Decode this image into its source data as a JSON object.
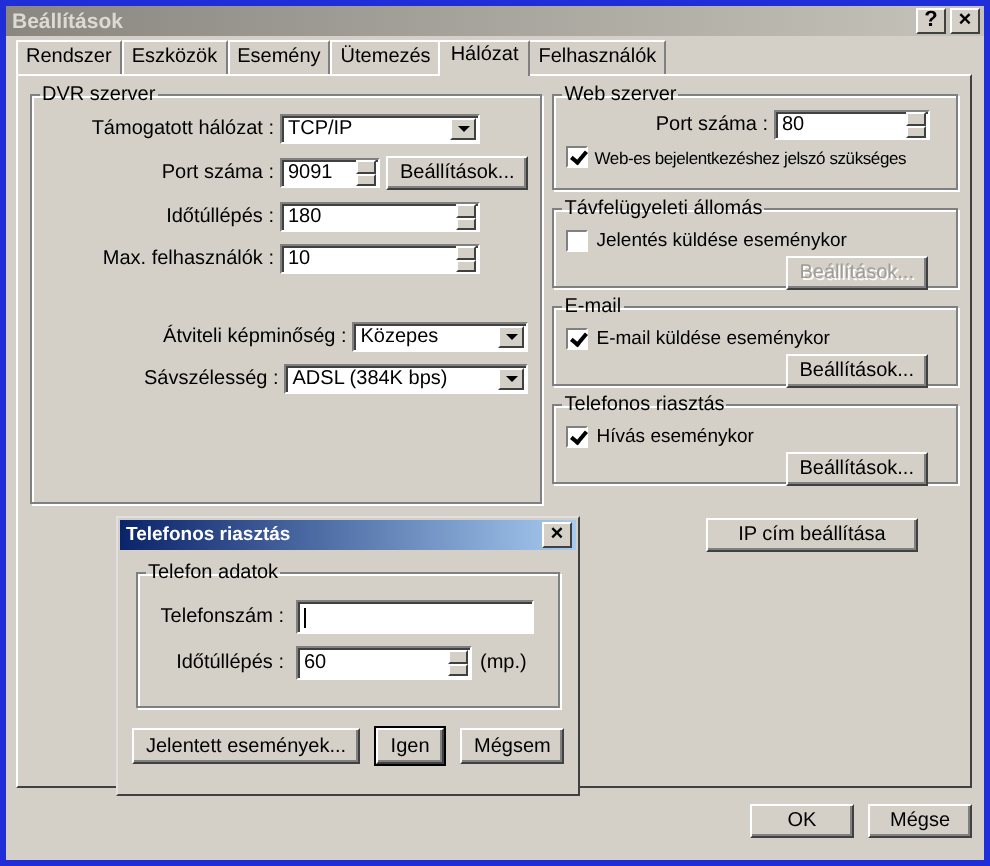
{
  "window": {
    "title": "Beállítások",
    "title_buttons": [
      "?",
      "×"
    ]
  },
  "tabs": [
    {
      "label": "Rendszer",
      "selected": false
    },
    {
      "label": "Eszközök",
      "selected": false
    },
    {
      "label": "Esemény",
      "selected": false
    },
    {
      "label": "Ütemezés",
      "selected": false
    },
    {
      "label": "Hálózat",
      "selected": true
    },
    {
      "label": "Felhasználók",
      "selected": false
    }
  ],
  "dvr_server": {
    "title": "DVR szerver",
    "fields": [
      {
        "kind": "dropdown",
        "label": "Támogatott hálózat :",
        "value": "TCP/IP"
      },
      {
        "kind": "spin",
        "label": "Port száma :",
        "value": "9091",
        "button": "Beállítások..."
      },
      {
        "kind": "spin",
        "label": "Időtúllépés :",
        "value": "180"
      },
      {
        "kind": "spin",
        "label": "Max. felhasználók :",
        "value": "10"
      }
    ],
    "quality_fields": [
      {
        "kind": "dropdown",
        "label": "Átviteli képminőség :",
        "value": "Közepes"
      },
      {
        "kind": "dropdown",
        "label": "Sávszélesség :",
        "value": "ADSL (384K bps)"
      }
    ]
  },
  "web_server": {
    "title": "Web szerver",
    "port": {
      "label": "Port száma :",
      "value": "80"
    },
    "checkbox": {
      "label": "Web-es bejelentkezéshez jelszó szükséges",
      "checked": true
    }
  },
  "groups": [
    {
      "title": "Távfelügyeleti állomás",
      "checkbox": {
        "label": "Jelentés küldése eseménykor",
        "checked": false
      },
      "button": {
        "label": "Beállítások...",
        "disabled": true
      }
    },
    {
      "title": "E-mail",
      "checkbox": {
        "label": "E-mail küldése eseménykor",
        "checked": true
      },
      "button": {
        "label": "Beállítások...",
        "disabled": false
      }
    },
    {
      "title": "Telefonos riasztás",
      "checkbox": {
        "label": "Hívás eseménykor",
        "checked": true
      },
      "button": {
        "label": "Beállítások...",
        "disabled": false
      }
    }
  ],
  "ip_button": "IP cím beállítása",
  "dialog": {
    "title": "Telefonos riasztás",
    "close": "×",
    "group_title": "Telefon adatok",
    "fields": [
      {
        "kind": "text",
        "label": "Telefonszám :"
      },
      {
        "kind": "spin",
        "label": "Időtúllépés :",
        "value": "60",
        "unit": "(mp.)"
      }
    ],
    "buttons": [
      {
        "label": "Jelentett események...",
        "default": false
      },
      {
        "label": "Igen",
        "default": true
      },
      {
        "label": "Mégsem",
        "default": false
      }
    ]
  },
  "footer_buttons": [
    "OK",
    "Mégse"
  ]
}
